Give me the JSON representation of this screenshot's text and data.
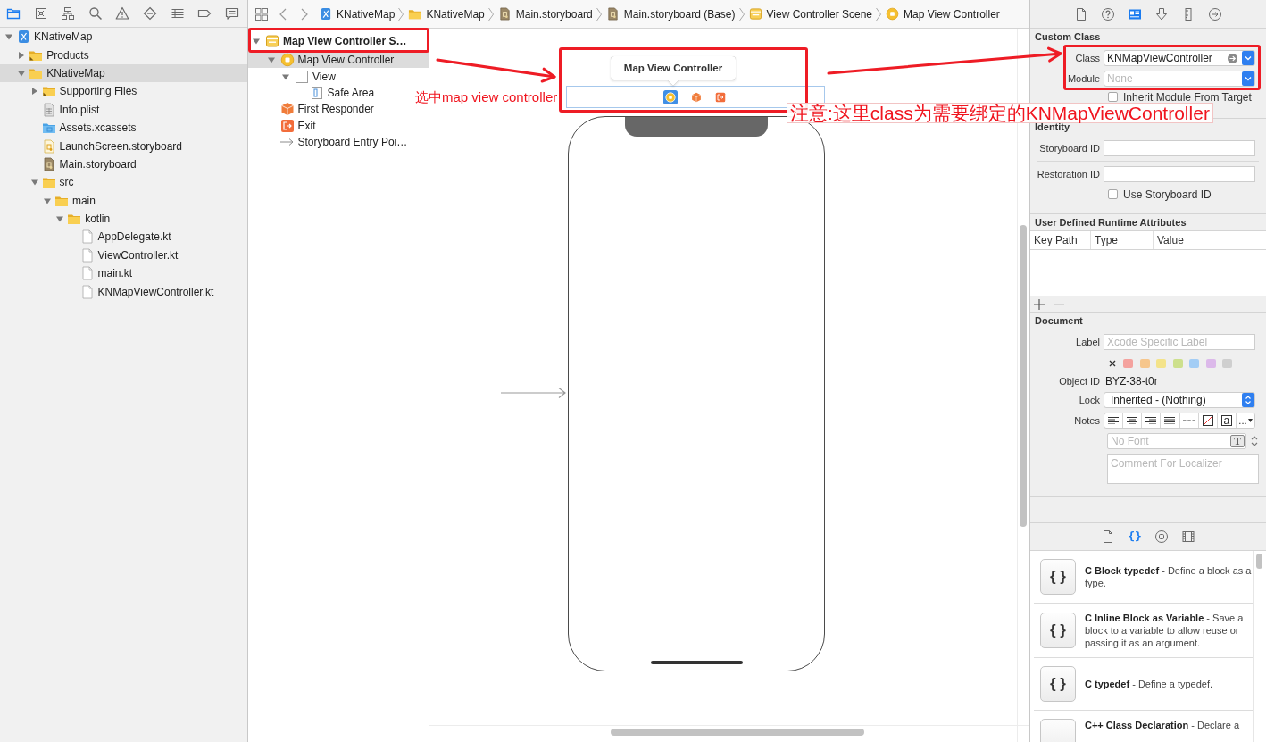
{
  "navigator": {
    "toolbar": [
      {
        "kind": "project",
        "selected": true
      },
      {
        "kind": "source",
        "selected": false
      },
      {
        "kind": "symbols",
        "selected": false
      },
      {
        "kind": "find",
        "selected": false
      },
      {
        "kind": "issues",
        "selected": false
      },
      {
        "kind": "tests",
        "selected": false
      },
      {
        "kind": "debug",
        "selected": false
      },
      {
        "kind": "breakpoints",
        "selected": false
      },
      {
        "kind": "reports",
        "selected": false
      }
    ],
    "tree": [
      {
        "label": "KNativeMap",
        "kind": "project",
        "expanded": true,
        "selected": false,
        "children": [
          {
            "label": "Products",
            "kind": "smartfolder",
            "expanded": false,
            "selected": false
          },
          {
            "label": "KNativeMap",
            "kind": "folder",
            "expanded": true,
            "selected": true,
            "children": [
              {
                "label": "Supporting Files",
                "kind": "smartfolder",
                "expanded": false,
                "selected": false
              },
              {
                "label": "Info.plist",
                "kind": "plist",
                "selected": false
              },
              {
                "label": "Assets.xcassets",
                "kind": "assets",
                "selected": false
              },
              {
                "label": "LaunchScreen.storyboard",
                "kind": "launchscreen",
                "selected": false
              },
              {
                "label": "Main.storyboard",
                "kind": "storyboard",
                "selected": false
              },
              {
                "label": "src",
                "kind": "folder",
                "expanded": true,
                "selected": false,
                "children": [
                  {
                    "label": "main",
                    "kind": "folder",
                    "expanded": true,
                    "selected": false,
                    "children": [
                      {
                        "label": "kotlin",
                        "kind": "folder",
                        "expanded": true,
                        "selected": false,
                        "children": [
                          {
                            "label": "AppDelegate.kt",
                            "kind": "source",
                            "selected": false
                          },
                          {
                            "label": "ViewController.kt",
                            "kind": "source",
                            "selected": false
                          },
                          {
                            "label": "main.kt",
                            "kind": "source",
                            "selected": false
                          },
                          {
                            "label": "KNMapViewController.kt",
                            "kind": "source",
                            "selected": false
                          }
                        ]
                      }
                    ]
                  }
                ]
              }
            ]
          }
        ]
      }
    ]
  },
  "editor": {
    "jump_bar": [
      {
        "label": "KNativeMap",
        "kind": "project"
      },
      {
        "label": "KNativeMap",
        "kind": "folder"
      },
      {
        "label": "Main.storyboard",
        "kind": "storyboard"
      },
      {
        "label": "Main.storyboard (Base)",
        "kind": "storyboard"
      },
      {
        "label": "View Controller Scene",
        "kind": "scene"
      },
      {
        "label": "Map View Controller",
        "kind": "viewcontroller"
      }
    ],
    "outline": [
      {
        "label": "Map View Controller S…",
        "kind": "scene",
        "expanded": true,
        "selected": false,
        "children": [
          {
            "label": "Map View Controller",
            "kind": "viewcontroller",
            "expanded": true,
            "selected": true,
            "children": [
              {
                "label": "View",
                "kind": "view",
                "expanded": true,
                "selected": false,
                "children": [
                  {
                    "label": "Safe Area",
                    "kind": "safearea",
                    "selected": false
                  }
                ]
              }
            ]
          },
          {
            "label": "First Responder",
            "kind": "responder",
            "selected": false
          },
          {
            "label": "Exit",
            "kind": "exit",
            "selected": false
          },
          {
            "label": "Storyboard Entry Poi…",
            "kind": "entry",
            "selected": false
          }
        ]
      }
    ],
    "canvas": {
      "tooltip": "Map View Controller",
      "dock": [
        {
          "kind": "viewcontroller",
          "selected": true
        },
        {
          "kind": "responder",
          "selected": false
        },
        {
          "kind": "exit",
          "selected": false
        }
      ]
    }
  },
  "inspector": {
    "tabs": [
      {
        "kind": "file",
        "selected": false
      },
      {
        "kind": "help",
        "selected": false
      },
      {
        "kind": "identity",
        "selected": true
      },
      {
        "kind": "attributes",
        "selected": false
      },
      {
        "kind": "size",
        "selected": false
      },
      {
        "kind": "connections",
        "selected": false
      }
    ],
    "custom_class": {
      "title": "Custom Class",
      "class_field": {
        "label": "Class",
        "value": "KNMapViewController"
      },
      "module_field": {
        "label": "Module",
        "placeholder": "None"
      },
      "inherit": {
        "label": "Inherit Module From Target",
        "checked": false
      }
    },
    "identity": {
      "title": "Identity",
      "storyboard_id": {
        "label": "Storyboard ID"
      },
      "restoration_id": {
        "label": "Restoration ID"
      },
      "use_storyboard_id": {
        "label": "Use Storyboard ID",
        "checked": false
      }
    },
    "runtime_attributes": {
      "title": "User Defined Runtime Attributes",
      "columns": [
        "Key Path",
        "Type",
        "Value"
      ],
      "buttons": [
        {
          "kind": "add",
          "disabled": false
        },
        {
          "kind": "remove",
          "disabled": true
        }
      ]
    },
    "document": {
      "title": "Document",
      "label_field": {
        "label": "Label",
        "placeholder": "Xcode Specific Label"
      },
      "label_colors": [
        {
          "color": "#f4a29e"
        },
        {
          "color": "#f6c68c"
        },
        {
          "color": "#f4e38a"
        },
        {
          "color": "#cde08c"
        },
        {
          "color": "#a3cdf5"
        },
        {
          "color": "#dcb9ea"
        },
        {
          "color": "#cfcfcf"
        }
      ],
      "object_id": {
        "label": "Object ID",
        "value": "BYZ-38-t0r"
      },
      "lock": {
        "label": "Lock",
        "value": "Inherited - (Nothing)"
      },
      "notes": {
        "label": "Notes",
        "tools": [
          {
            "kind": "left"
          },
          {
            "kind": "center"
          },
          {
            "kind": "right"
          },
          {
            "kind": "justify"
          },
          {
            "kind": "dashes"
          },
          {
            "kind": "slash"
          },
          {
            "kind": "letter",
            "text": "a"
          },
          {
            "kind": "more",
            "text": "..."
          }
        ]
      },
      "font_field": {
        "placeholder": "No Font",
        "button": "T"
      },
      "comment_field": {
        "placeholder": "Comment For Localizer"
      }
    }
  },
  "library": {
    "tabs": [
      {
        "kind": "file",
        "selected": false
      },
      {
        "kind": "snippet",
        "text": "{}",
        "selected": true
      },
      {
        "kind": "object",
        "selected": false
      },
      {
        "kind": "media",
        "selected": false
      }
    ],
    "items": [
      {
        "icon": "{ }",
        "text": "**C Block typedef** - Define a block as a type."
      },
      {
        "icon": "{ }",
        "text": "**C Inline Block as Variable** - Save a block to a variable to allow reuse or passing it as an argument."
      },
      {
        "icon": "{ }",
        "text": "**C typedef** - Define a typedef."
      },
      {
        "text": "**C++ Class Declaration** - Declare a"
      }
    ]
  },
  "annotations": [
    {
      "kind": "frame"
    },
    {
      "kind": "frame"
    },
    {
      "kind": "frame"
    },
    {
      "kind": "arrow"
    },
    {
      "kind": "arrow"
    },
    {
      "kind": "label",
      "text": "选中map view controller"
    },
    {
      "kind": "callout",
      "text": "注意:这里class为需要绑定的KNMapViewController"
    }
  ]
}
